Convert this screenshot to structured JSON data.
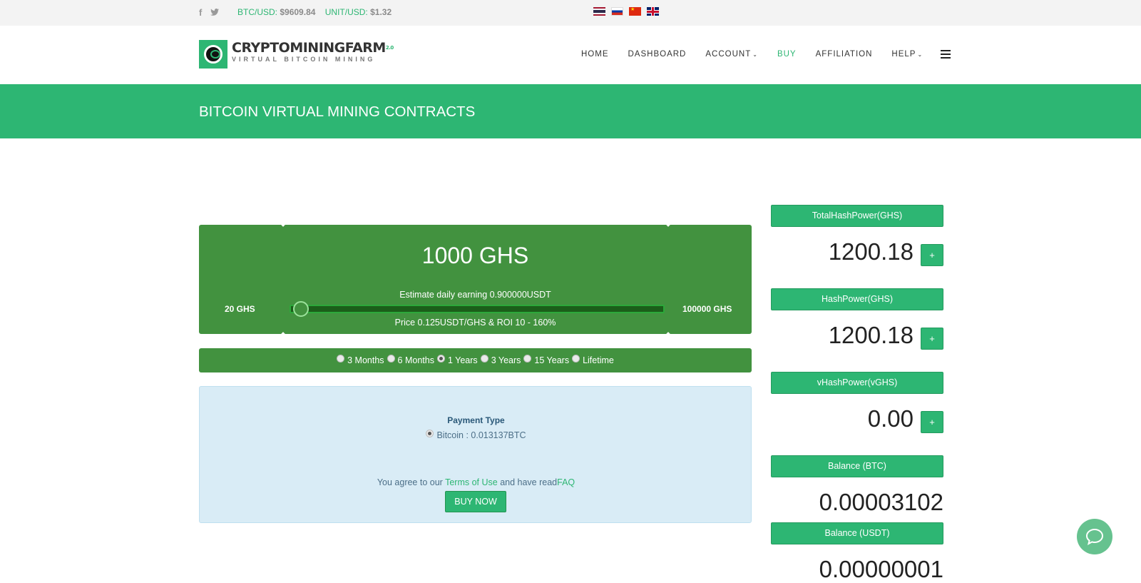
{
  "topbar": {
    "social_icons": [
      "facebook-icon",
      "twitter-icon"
    ],
    "btc_label": "BTC/USD:",
    "btc_value": "$9609.84",
    "unit_label": "UNIT/USD:",
    "unit_value": "$1.32",
    "flags": [
      "thailand-flag",
      "russia-flag",
      "china-flag",
      "uk-flag"
    ]
  },
  "header": {
    "logo_title": "CRYPTOMININGFARM",
    "logo_version": "2.0",
    "logo_subtitle": "VIRTUAL BITCOIN MINING",
    "nav": {
      "home": "HOME",
      "dashboard": "DASHBOARD",
      "account": "ACCOUNT",
      "buy": "BUY",
      "affiliation": "AFFILIATION",
      "help": "HELP"
    }
  },
  "banner": {
    "title": "BITCOIN VIRTUAL MINING CONTRACTS"
  },
  "slider": {
    "selected": "1000 GHS",
    "min_label": "20 GHS",
    "max_label": "100000 GHS",
    "estimate": "Estimate daily earning 0.900000USDT",
    "price": "Price 0.125USDT/GHS & ROI 10 - 160%",
    "min": 20,
    "max": 100000,
    "value": 1000
  },
  "periods": {
    "options": [
      "3 Months",
      "6 Months",
      "1 Years",
      "3 Years",
      "15 Years",
      "Lifetime"
    ],
    "selected": "1 Years"
  },
  "payment": {
    "title": "Payment Type",
    "option": "Bitcoin : 0.013137BTC",
    "agree_prefix": "You agree to our ",
    "terms_link": "Terms of Use",
    "agree_middle": " and have read",
    "faq_link": "FAQ",
    "buy_button": "BUY NOW"
  },
  "stats": {
    "total_hash": {
      "label": "TotalHashPower(GHS)",
      "value": "1200.18",
      "button": "+"
    },
    "hash": {
      "label": "HashPower(GHS)",
      "value": "1200.18",
      "button": "+"
    },
    "vhash": {
      "label": "vHashPower(vGHS)",
      "value": "0.00",
      "button": "+"
    },
    "balance_btc": {
      "label": "Balance (BTC)",
      "value": "0.00003102"
    },
    "balance_usdt": {
      "label": "Balance (USDT)",
      "value": "0.00000001"
    }
  },
  "colors": {
    "brand": "#2db673",
    "panel": "#42923f",
    "payment_bg": "#d9ecf6"
  }
}
